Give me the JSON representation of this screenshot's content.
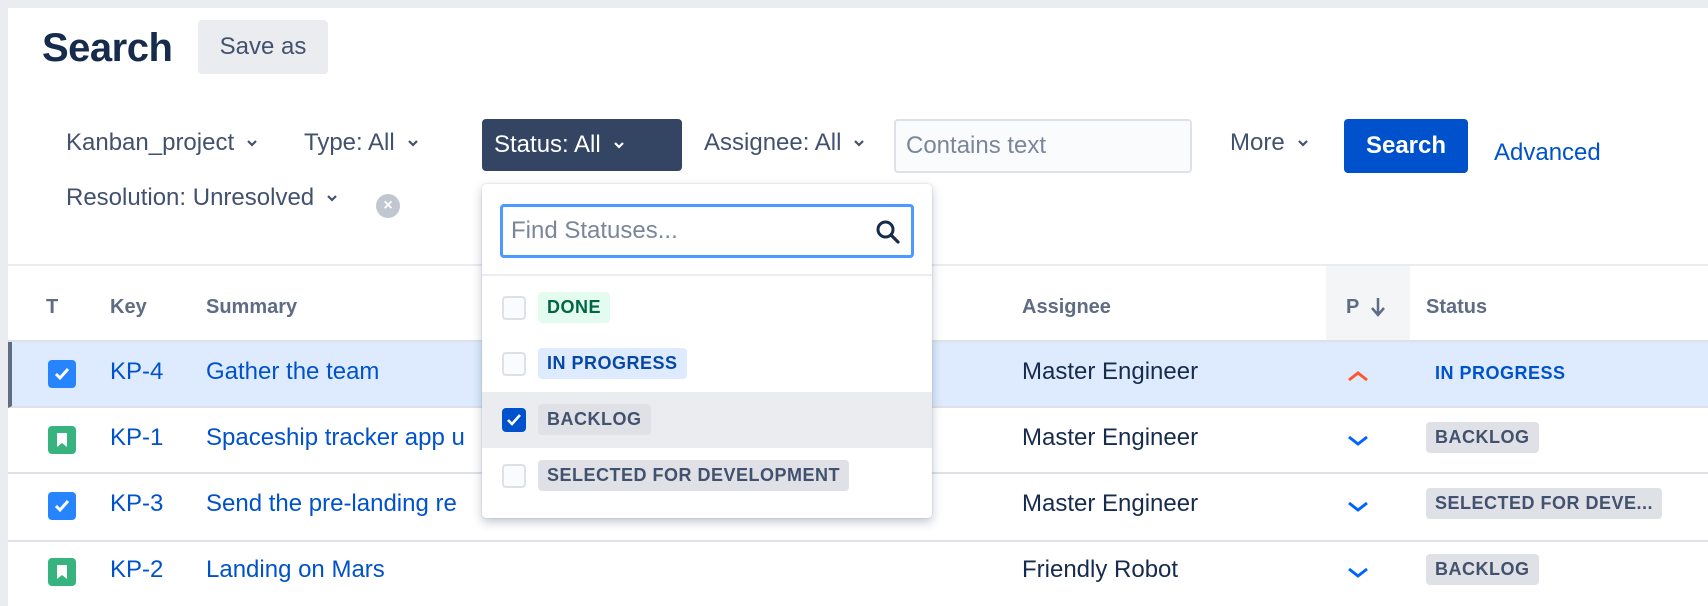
{
  "header": {
    "title": "Search",
    "save_as": "Save as"
  },
  "filters": {
    "project": "Kanban_project",
    "type": "Type: All",
    "status": "Status: All",
    "assignee": "Assignee: All",
    "text_placeholder": "Contains text",
    "more": "More",
    "search_button": "Search",
    "advanced": "Advanced",
    "resolution": "Resolution: Unresolved"
  },
  "table": {
    "columns": {
      "type": "T",
      "key": "Key",
      "summary": "Summary",
      "assignee": "Assignee",
      "priority": "P",
      "status": "Status"
    },
    "rows": [
      {
        "type": "task",
        "key": "KP-4",
        "summary": "Gather the team",
        "assignee": "Master Engineer",
        "priority": "high",
        "status": "IN PROGRESS",
        "selected": true
      },
      {
        "type": "story",
        "key": "KP-1",
        "summary": "Spaceship tracker app u",
        "assignee": "Master Engineer",
        "priority": "low",
        "status": "BACKLOG"
      },
      {
        "type": "task",
        "key": "KP-3",
        "summary": "Send the pre-landing re",
        "assignee": "Master Engineer",
        "priority": "low",
        "status": "SELECTED FOR DEVE..."
      },
      {
        "type": "story",
        "key": "KP-2",
        "summary": "Landing on Mars",
        "assignee": "Friendly Robot",
        "priority": "low",
        "status": "BACKLOG"
      }
    ]
  },
  "status_dropdown": {
    "search_placeholder": "Find Statuses...",
    "options": [
      {
        "label": "DONE",
        "checked": false
      },
      {
        "label": "IN PROGRESS",
        "checked": false
      },
      {
        "label": "BACKLOG",
        "checked": true
      },
      {
        "label": "SELECTED FOR DEVELOPMENT",
        "checked": false
      }
    ]
  },
  "icons": [
    "chevron-down-icon",
    "clear-icon",
    "search-icon",
    "sort-down-arrow-icon",
    "task-checkbox-icon",
    "story-bookmark-icon",
    "priority-high-icon",
    "priority-low-icon",
    "checkmark-icon"
  ],
  "colors": {
    "primary": "#0052cc",
    "active_filter": "#344563",
    "selected_row": "#deebff",
    "story": "#36b37e",
    "task": "#2684ff",
    "priority_high": "#ff5630"
  }
}
